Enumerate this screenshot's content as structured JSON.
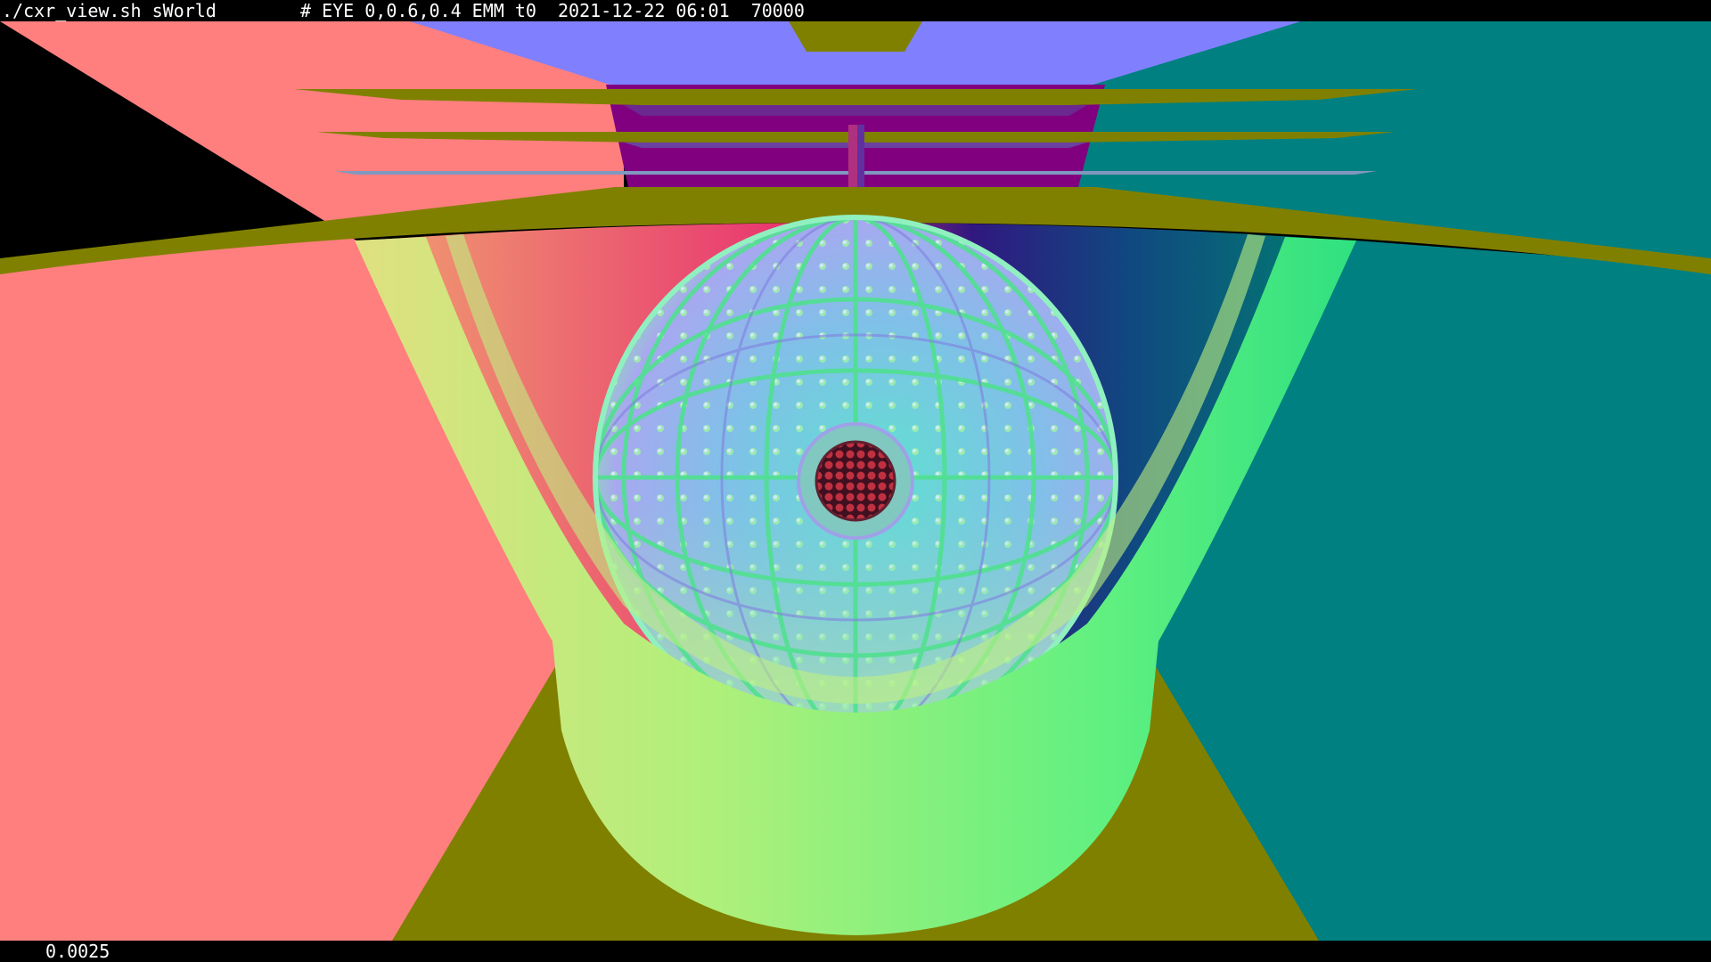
{
  "header": {
    "command": "./cxr_view.sh sWorld",
    "status": "# EYE 0,0.6,0.4 EMM t0  2021-12-22 06:01  70000"
  },
  "footer": {
    "value": "0.0025"
  },
  "render": {
    "colors": {
      "left_wall": "#ff7f7f",
      "right_wall": "#008080",
      "ceiling": "#8080ff",
      "olive": "#808000",
      "magenta": "#800080",
      "tub_green": "#7ff07f"
    }
  }
}
